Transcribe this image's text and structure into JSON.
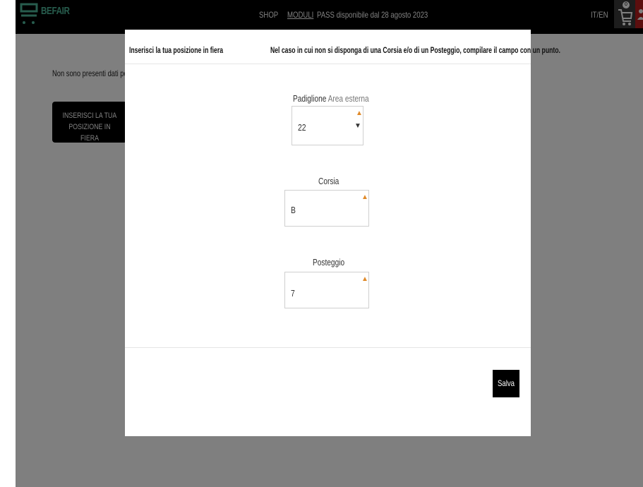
{
  "navbar": {
    "brand": "BEFAIR",
    "links": [
      "SHOP",
      "MODULI"
    ],
    "pass_text": "PASS disponibile dal 28 agosto 2023",
    "lang": "IT/EN",
    "cart_count": "0",
    "icons": [
      "cart-icon",
      "user-icon"
    ]
  },
  "page": {
    "notice": "Non sono presenti dati per l",
    "insert_button": [
      "INSERISCI LA TUA",
      "POSIZIONE IN FIERA"
    ]
  },
  "modal": {
    "title": "Inserisci la tua posizione in fiera",
    "hint": "Nel caso in cui non si disponga di una Corsia e/o di un Posteggio, compilare il campo con un punto.",
    "fields": {
      "padiglione": {
        "label": "Padiglione",
        "sublabel": "Area esterna",
        "value": "22",
        "required": true
      },
      "corsia": {
        "label": "Corsia",
        "value": "B",
        "required": true
      },
      "posteggio": {
        "label": "Posteggio",
        "value": "7",
        "required": true
      }
    },
    "save_label": "Salva"
  },
  "colors": {
    "brand": "#4fb99a",
    "required_marker": "#e08a2a",
    "navbar_bg": "#000000",
    "overlay": "rgba(0,0,0,0.5)"
  }
}
